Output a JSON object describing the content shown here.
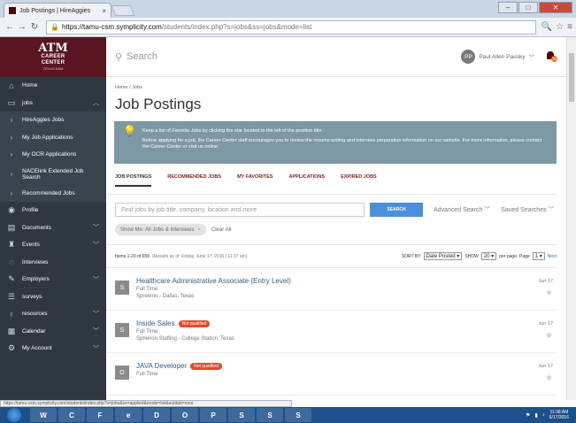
{
  "browser": {
    "tab_title": "Job Postings | HireAggies",
    "url_host": "https://tamu-csm.symplicity.com",
    "url_path": "/students/index.php?s=jobs&ss=jobs&mode=list",
    "status_url": "https://tamu-csm.symplicity.com/students/index.php?s=jobs&ss=applied&mode=list&subtab=noor"
  },
  "brand": {
    "line1": "CAREER",
    "line2": "CENTER",
    "line3": "TEXAS A&M",
    "mark": "ATM"
  },
  "sidebar": {
    "items": [
      {
        "label": "Home",
        "icon": "home-icon"
      },
      {
        "label": "jobs",
        "icon": "briefcase-icon"
      },
      {
        "label": "HireAggies Jobs",
        "icon": "chevron-right-icon"
      },
      {
        "label": "My Job Applications",
        "icon": "chevron-right-icon"
      },
      {
        "label": "My OCR Applications",
        "icon": "chevron-right-icon"
      },
      {
        "label": "NACElink Extended Job Search",
        "icon": "chevron-right-icon"
      },
      {
        "label": "Recommended Jobs",
        "icon": "chevron-right-icon"
      },
      {
        "label": "Profile",
        "icon": "profile-icon"
      },
      {
        "label": "Documents",
        "icon": "documents-icon"
      },
      {
        "label": "Events",
        "icon": "events-icon"
      },
      {
        "label": "Interviews",
        "icon": "interviews-icon"
      },
      {
        "label": "Employers",
        "icon": "employers-icon"
      },
      {
        "label": "surveys",
        "icon": "surveys-icon"
      },
      {
        "label": "resources",
        "icon": "resources-icon"
      },
      {
        "label": "Calendar",
        "icon": "calendar-icon"
      },
      {
        "label": "My Account",
        "icon": "account-icon"
      }
    ]
  },
  "header": {
    "search_placeholder": "Search",
    "user_initials": "PP",
    "user_name": "Paul Allen Pausky",
    "notifications": "10"
  },
  "breadcrumb": "Home / Jobs",
  "page_title": "Job Postings",
  "alert": {
    "line1": "Keep a list of Favorite Jobs by clicking the star located to the left of the position title.",
    "line2": "Before applying for a job, the Career Center staff encourages you to review the resume writing and interview preparation information on our website. For more information, please contact the Career Center or visit us online."
  },
  "tabs": [
    "JOB POSTINGS",
    "RECOMMENDED JOBS",
    "MY FAVORITES",
    "APPLICATIONS",
    "EXPIRED JOBS"
  ],
  "search": {
    "placeholder": "Find jobs by job title, company, location and more",
    "button": "SEARCH",
    "advanced": "Advanced Search",
    "saved": "Saved Searches"
  },
  "filter": {
    "pill": "Show Me: All Jobs & Interviews",
    "clear": "Clear All"
  },
  "results": {
    "summary": "Items 1-20 of 659",
    "as_of": "(Results as of: Friday, June 17, 2016 | 11:37 am)",
    "sort_label": "SORT BY",
    "sort_value": "Date Posted",
    "show_label": "SHOW",
    "show_value": "20",
    "per_page": "per page",
    "page_label": "Page",
    "page_value": "1",
    "next": "Next"
  },
  "jobs": [
    {
      "initial": "S",
      "title": "Healthcare Administrative Associate (Entry Level)",
      "badge": "",
      "type": "Full Time",
      "employer": "Spreemo - Dallas, Texas",
      "date": "Jun 17"
    },
    {
      "initial": "S",
      "title": "Inside Sales",
      "badge": "Not qualified",
      "type": "Full Time",
      "employer": "Spherion Staffing - College Station, Texas",
      "date": "Jun 17"
    },
    {
      "initial": "O",
      "title": "JAVA Developer",
      "badge": "Not qualified",
      "type": "Full Time",
      "employer": "",
      "date": "Jun 17"
    }
  ],
  "taskbar": {
    "time": "11:38 AM",
    "date": "6/17/2016",
    "apps": [
      "W",
      "C",
      "F",
      "e",
      "D",
      "O",
      "P",
      "S",
      "S",
      "S"
    ]
  },
  "colors": {
    "brand": "#500000",
    "sidebar": "#2f3841",
    "accent": "#4a90d9",
    "alert": "#7e97a4",
    "badge": "#e34a2e"
  }
}
